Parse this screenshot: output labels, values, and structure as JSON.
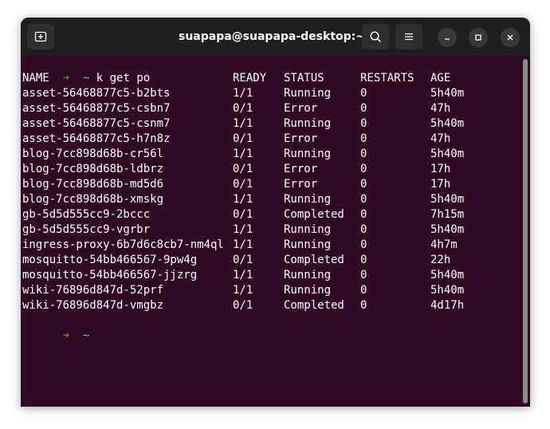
{
  "window": {
    "title": "suapapa@suapapa-desktop:~"
  },
  "prompt": {
    "arrow": "➜",
    "dir": "~",
    "command": "k get po"
  },
  "table": {
    "headers": [
      "NAME",
      "READY",
      "STATUS",
      "RESTARTS",
      "AGE"
    ],
    "rows": [
      [
        "asset-56468877c5-b2bts",
        "1/1",
        "Running",
        "0",
        "5h40m"
      ],
      [
        "asset-56468877c5-csbn7",
        "0/1",
        "Error",
        "0",
        "47h"
      ],
      [
        "asset-56468877c5-csnm7",
        "1/1",
        "Running",
        "0",
        "5h40m"
      ],
      [
        "asset-56468877c5-h7n8z",
        "0/1",
        "Error",
        "0",
        "47h"
      ],
      [
        "blog-7cc898d68b-cr56l",
        "1/1",
        "Running",
        "0",
        "5h40m"
      ],
      [
        "blog-7cc898d68b-ldbrz",
        "0/1",
        "Error",
        "0",
        "17h"
      ],
      [
        "blog-7cc898d68b-md5d6",
        "0/1",
        "Error",
        "0",
        "17h"
      ],
      [
        "blog-7cc898d68b-xmskg",
        "1/1",
        "Running",
        "0",
        "5h40m"
      ],
      [
        "gb-5d5d555cc9-2bccc",
        "0/1",
        "Completed",
        "0",
        "7h15m"
      ],
      [
        "gb-5d5d555cc9-vgrbr",
        "1/1",
        "Running",
        "0",
        "5h40m"
      ],
      [
        "ingress-proxy-6b7d6c8cb7-nm4ql",
        "1/1",
        "Running",
        "0",
        "4h7m"
      ],
      [
        "mosquitto-54bb466567-9pw4g",
        "0/1",
        "Completed",
        "0",
        "22h"
      ],
      [
        "mosquitto-54bb466567-jjzrg",
        "1/1",
        "Running",
        "0",
        "5h40m"
      ],
      [
        "wiki-76896d847d-52prf",
        "1/1",
        "Running",
        "0",
        "5h40m"
      ],
      [
        "wiki-76896d847d-vmgbz",
        "0/1",
        "Completed",
        "0",
        "4d17h"
      ]
    ]
  },
  "prompt2": {
    "arrow": "➜",
    "dir": "~"
  },
  "colors": {
    "terminal_bg": "#300a24",
    "titlebar_bg": "#1f1f1f",
    "prompt_arrow": "#4e9a06",
    "prompt_dir": "#34e2e2"
  }
}
